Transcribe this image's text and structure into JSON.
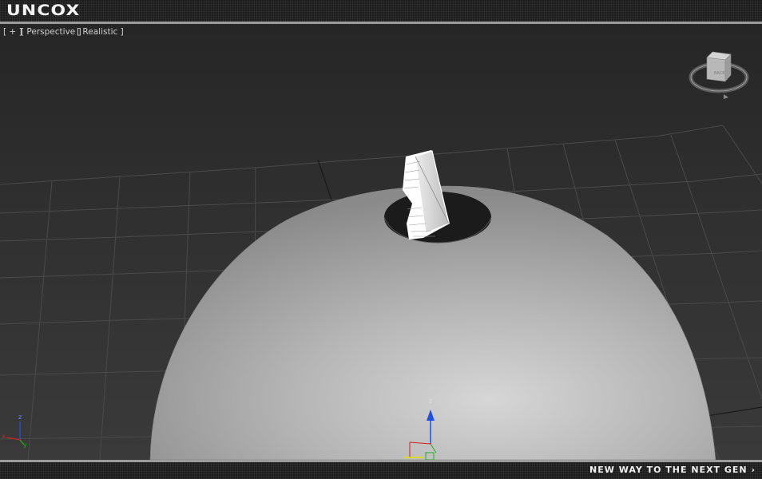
{
  "brand": {
    "logo_text": "UNCOX"
  },
  "viewport": {
    "labels": {
      "plus": "[ + ]",
      "view": "[ Perspective ]",
      "shading": "[ Realistic ]"
    },
    "viewcube": {
      "face_label": "BACK"
    },
    "axes": {
      "x": "x",
      "y": "y",
      "z": "z"
    }
  },
  "footer": {
    "tagline": "NEW WAY TO THE NEXT GEN ›"
  },
  "colors": {
    "background": "#2a2a2a",
    "grid": "#4a4a4a",
    "divider": "#9c9c9c",
    "axis_x": "#d02020",
    "axis_y": "#20b020",
    "axis_z": "#2050e0"
  }
}
